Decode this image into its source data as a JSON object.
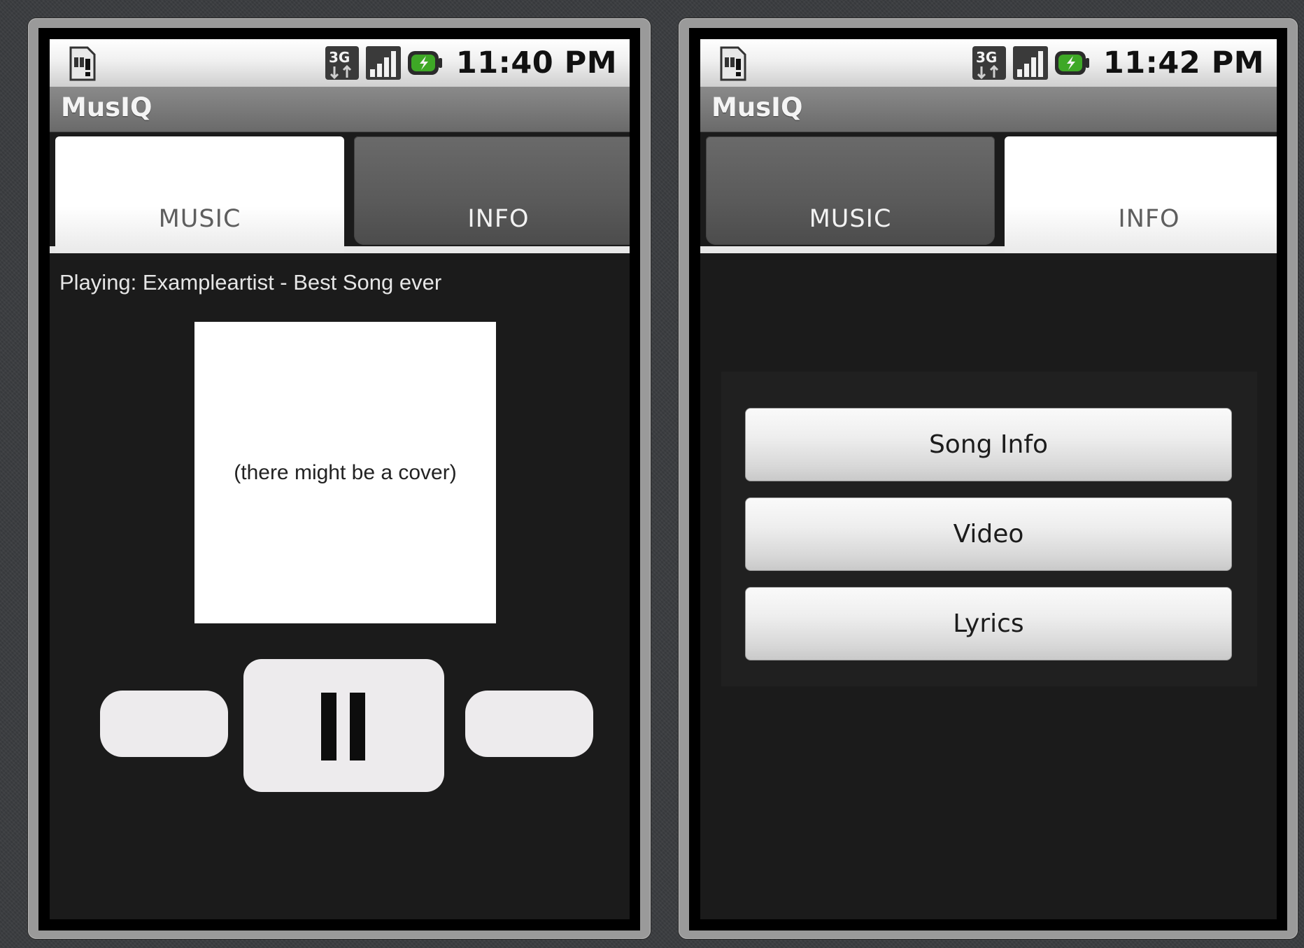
{
  "screens": [
    {
      "status_bar": {
        "time": "11:40 PM",
        "icons": [
          "sd-card-warning-icon",
          "3g-data-icon",
          "signal-strength-icon",
          "battery-charging-icon"
        ]
      },
      "app_title": "MusIQ",
      "tabs": [
        {
          "label": "MUSIC",
          "selected": true
        },
        {
          "label": "INFO",
          "selected": false
        }
      ],
      "now_playing": "Playing: Exampleartist - Best Song ever",
      "cover_placeholder": "(there might be a cover)",
      "controls": {
        "previous_icon": "previous-button",
        "pause_icon": "pause-icon",
        "next_icon": "next-button"
      }
    },
    {
      "status_bar": {
        "time": "11:42 PM",
        "icons": [
          "sd-card-warning-icon",
          "3g-data-icon",
          "signal-strength-icon",
          "battery-charging-icon"
        ]
      },
      "app_title": "MusIQ",
      "tabs": [
        {
          "label": "MUSIC",
          "selected": false
        },
        {
          "label": "INFO",
          "selected": true
        }
      ],
      "buttons": [
        "Song Info",
        "Video",
        "Lyrics"
      ]
    }
  ],
  "colors": {
    "selected_tab": "#ffffff",
    "unselected_tab": "#5a5a5a",
    "screen_background": "#1b1b1b",
    "title_bar": "#7a7a7a",
    "battery_accent": "#3ea826"
  }
}
